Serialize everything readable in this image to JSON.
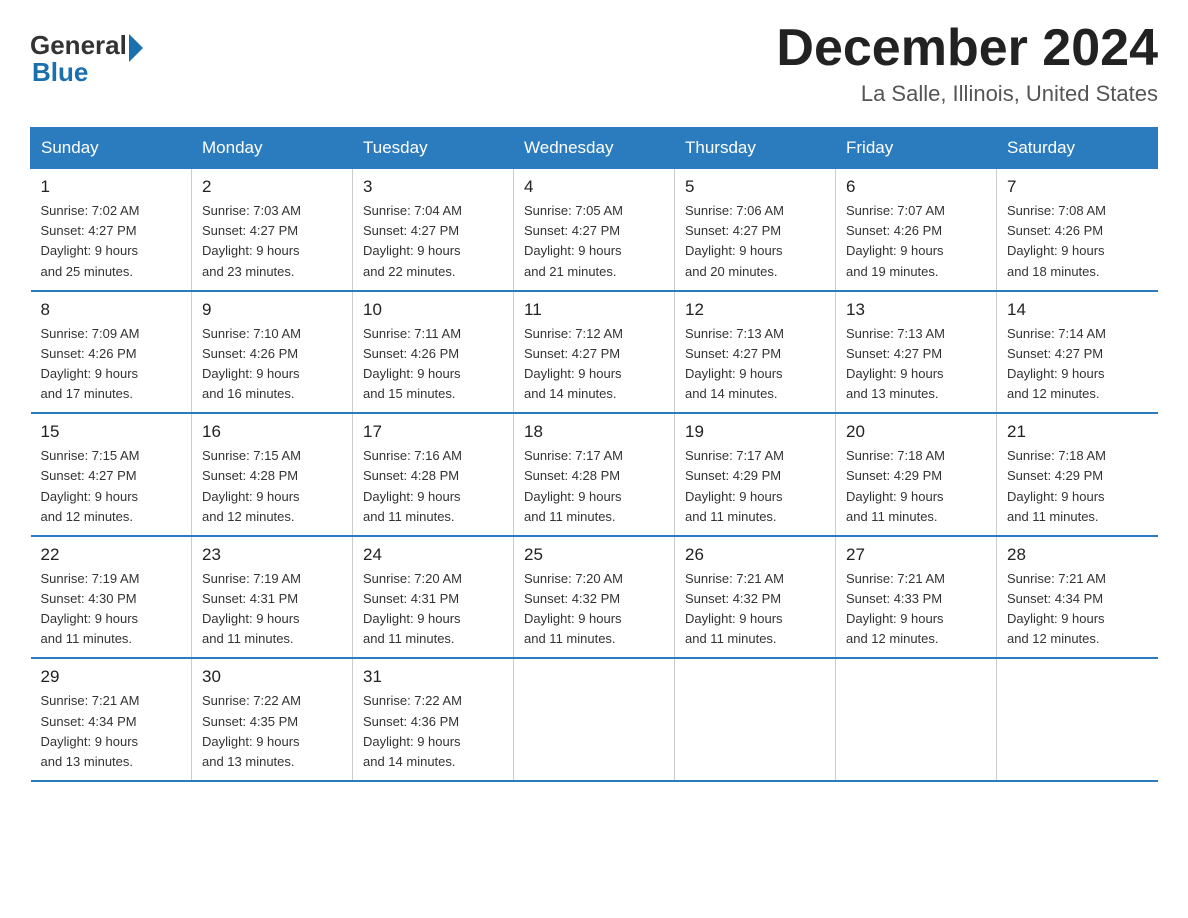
{
  "header": {
    "logo_general": "General",
    "logo_blue": "Blue",
    "month_title": "December 2024",
    "location": "La Salle, Illinois, United States"
  },
  "days_of_week": [
    "Sunday",
    "Monday",
    "Tuesday",
    "Wednesday",
    "Thursday",
    "Friday",
    "Saturday"
  ],
  "weeks": [
    [
      {
        "day": "1",
        "sunrise": "7:02 AM",
        "sunset": "4:27 PM",
        "daylight": "9 hours and 25 minutes."
      },
      {
        "day": "2",
        "sunrise": "7:03 AM",
        "sunset": "4:27 PM",
        "daylight": "9 hours and 23 minutes."
      },
      {
        "day": "3",
        "sunrise": "7:04 AM",
        "sunset": "4:27 PM",
        "daylight": "9 hours and 22 minutes."
      },
      {
        "day": "4",
        "sunrise": "7:05 AM",
        "sunset": "4:27 PM",
        "daylight": "9 hours and 21 minutes."
      },
      {
        "day": "5",
        "sunrise": "7:06 AM",
        "sunset": "4:27 PM",
        "daylight": "9 hours and 20 minutes."
      },
      {
        "day": "6",
        "sunrise": "7:07 AM",
        "sunset": "4:26 PM",
        "daylight": "9 hours and 19 minutes."
      },
      {
        "day": "7",
        "sunrise": "7:08 AM",
        "sunset": "4:26 PM",
        "daylight": "9 hours and 18 minutes."
      }
    ],
    [
      {
        "day": "8",
        "sunrise": "7:09 AM",
        "sunset": "4:26 PM",
        "daylight": "9 hours and 17 minutes."
      },
      {
        "day": "9",
        "sunrise": "7:10 AM",
        "sunset": "4:26 PM",
        "daylight": "9 hours and 16 minutes."
      },
      {
        "day": "10",
        "sunrise": "7:11 AM",
        "sunset": "4:26 PM",
        "daylight": "9 hours and 15 minutes."
      },
      {
        "day": "11",
        "sunrise": "7:12 AM",
        "sunset": "4:27 PM",
        "daylight": "9 hours and 14 minutes."
      },
      {
        "day": "12",
        "sunrise": "7:13 AM",
        "sunset": "4:27 PM",
        "daylight": "9 hours and 14 minutes."
      },
      {
        "day": "13",
        "sunrise": "7:13 AM",
        "sunset": "4:27 PM",
        "daylight": "9 hours and 13 minutes."
      },
      {
        "day": "14",
        "sunrise": "7:14 AM",
        "sunset": "4:27 PM",
        "daylight": "9 hours and 12 minutes."
      }
    ],
    [
      {
        "day": "15",
        "sunrise": "7:15 AM",
        "sunset": "4:27 PM",
        "daylight": "9 hours and 12 minutes."
      },
      {
        "day": "16",
        "sunrise": "7:15 AM",
        "sunset": "4:28 PM",
        "daylight": "9 hours and 12 minutes."
      },
      {
        "day": "17",
        "sunrise": "7:16 AM",
        "sunset": "4:28 PM",
        "daylight": "9 hours and 11 minutes."
      },
      {
        "day": "18",
        "sunrise": "7:17 AM",
        "sunset": "4:28 PM",
        "daylight": "9 hours and 11 minutes."
      },
      {
        "day": "19",
        "sunrise": "7:17 AM",
        "sunset": "4:29 PM",
        "daylight": "9 hours and 11 minutes."
      },
      {
        "day": "20",
        "sunrise": "7:18 AM",
        "sunset": "4:29 PM",
        "daylight": "9 hours and 11 minutes."
      },
      {
        "day": "21",
        "sunrise": "7:18 AM",
        "sunset": "4:29 PM",
        "daylight": "9 hours and 11 minutes."
      }
    ],
    [
      {
        "day": "22",
        "sunrise": "7:19 AM",
        "sunset": "4:30 PM",
        "daylight": "9 hours and 11 minutes."
      },
      {
        "day": "23",
        "sunrise": "7:19 AM",
        "sunset": "4:31 PM",
        "daylight": "9 hours and 11 minutes."
      },
      {
        "day": "24",
        "sunrise": "7:20 AM",
        "sunset": "4:31 PM",
        "daylight": "9 hours and 11 minutes."
      },
      {
        "day": "25",
        "sunrise": "7:20 AM",
        "sunset": "4:32 PM",
        "daylight": "9 hours and 11 minutes."
      },
      {
        "day": "26",
        "sunrise": "7:21 AM",
        "sunset": "4:32 PM",
        "daylight": "9 hours and 11 minutes."
      },
      {
        "day": "27",
        "sunrise": "7:21 AM",
        "sunset": "4:33 PM",
        "daylight": "9 hours and 12 minutes."
      },
      {
        "day": "28",
        "sunrise": "7:21 AM",
        "sunset": "4:34 PM",
        "daylight": "9 hours and 12 minutes."
      }
    ],
    [
      {
        "day": "29",
        "sunrise": "7:21 AM",
        "sunset": "4:34 PM",
        "daylight": "9 hours and 13 minutes."
      },
      {
        "day": "30",
        "sunrise": "7:22 AM",
        "sunset": "4:35 PM",
        "daylight": "9 hours and 13 minutes."
      },
      {
        "day": "31",
        "sunrise": "7:22 AM",
        "sunset": "4:36 PM",
        "daylight": "9 hours and 14 minutes."
      },
      null,
      null,
      null,
      null
    ]
  ],
  "labels": {
    "sunrise": "Sunrise: ",
    "sunset": "Sunset: ",
    "daylight": "Daylight: "
  }
}
